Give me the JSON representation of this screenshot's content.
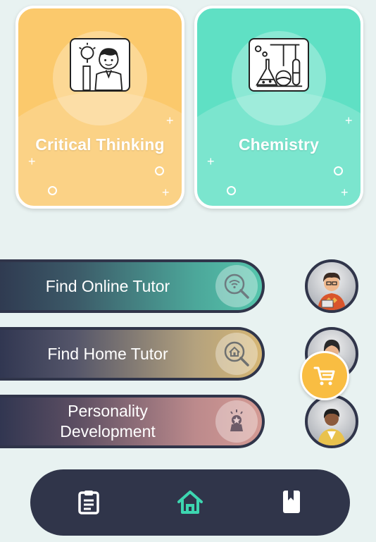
{
  "cards": [
    {
      "title": "Critical Thinking",
      "icon": "critical-thinking-icon",
      "color": "#fbc96c"
    },
    {
      "title": "Chemistry",
      "icon": "chemistry-lab-icon",
      "color": "#5fe0c4"
    }
  ],
  "menu": [
    {
      "label": "Find Online Tutor",
      "icon": "online-search-icon"
    },
    {
      "label": "Find Home Tutor",
      "icon": "home-search-icon"
    },
    {
      "label": "Personality Development",
      "icon": "award-icon"
    }
  ],
  "avatars": [
    "tutor-avatar-icon",
    "home-tutor-avatar-icon",
    "mentor-avatar-icon"
  ],
  "cart": {
    "icon": "cart-icon",
    "color": "#f9bd42"
  },
  "navbar": {
    "items": [
      {
        "icon": "clipboard-icon"
      },
      {
        "icon": "home-icon",
        "active": true
      },
      {
        "icon": "bookmark-book-icon"
      }
    ],
    "accent": "#3dd6b0"
  }
}
